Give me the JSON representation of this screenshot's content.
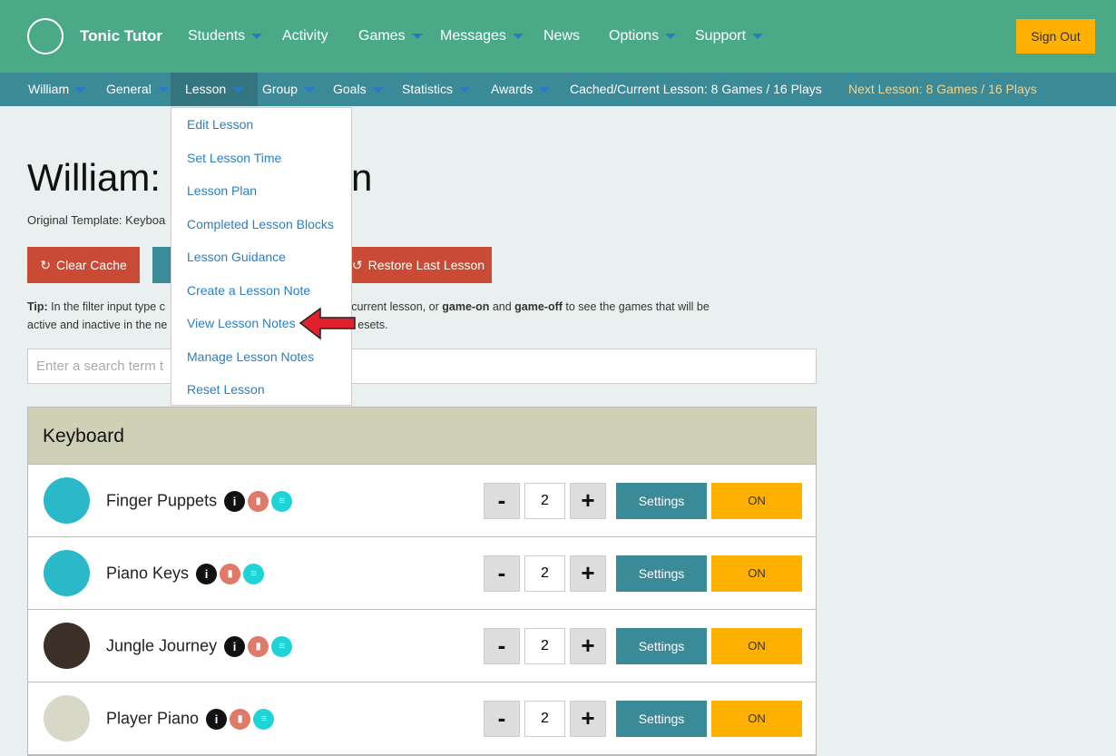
{
  "header": {
    "brand": "Tonic Tutor",
    "nav": [
      {
        "label": "Students",
        "caret": true
      },
      {
        "label": "Activity",
        "caret": false
      },
      {
        "label": "Games",
        "caret": true
      },
      {
        "label": "Messages",
        "caret": true
      },
      {
        "label": "News",
        "caret": false
      },
      {
        "label": "Options",
        "caret": true
      },
      {
        "label": "Support",
        "caret": true
      }
    ],
    "sign_out": "Sign Out"
  },
  "subnav": {
    "items": [
      "William",
      "General",
      "Lesson",
      "Group",
      "Goals",
      "Statistics",
      "Awards"
    ],
    "cached": "Cached/Current Lesson: 8 Games / 16 Plays",
    "next": "Next Lesson: 8 Games / 16 Plays"
  },
  "lesson_menu": [
    "Edit Lesson",
    "Set Lesson Time",
    "Lesson Plan",
    "Completed Lesson Blocks",
    "Lesson Guidance",
    "Create a Lesson Note",
    "View Lesson Notes",
    "Manage Lesson Notes",
    "Reset Lesson"
  ],
  "page": {
    "title_left": "William:",
    "title_right": "n",
    "template": "Original Template: Keyboa",
    "clear_cache": "Clear Cache",
    "restore": "Restore Last Lesson",
    "tip_label": "Tip:",
    "tip_a": " In the filter input type c",
    "tip_b": "mes active in the current lesson, or ",
    "tip_on": "game-on",
    "tip_and": " and ",
    "tip_off": "game-off",
    "tip_c": " to see the games that will be",
    "tip_d": "active and inactive in the ne",
    "tip_e": "esets.",
    "search_placeholder": "Enter a search term t"
  },
  "table": {
    "header": "Keyboard",
    "games": [
      {
        "name": "Finger Puppets",
        "qty": "2",
        "color": "#2bb8c8"
      },
      {
        "name": "Piano Keys",
        "qty": "2",
        "color": "#2bb8c8"
      },
      {
        "name": "Jungle Journey",
        "qty": "2",
        "color": "#3b2f27"
      },
      {
        "name": "Player Piano",
        "qty": "2",
        "color": "#d8d8c8"
      }
    ],
    "settings": "Settings",
    "on": "ON",
    "minus": "-",
    "plus": "+"
  },
  "colors": {
    "header": "#4aaa88",
    "subnav": "#3a8a98",
    "accent": "#ffb000",
    "danger": "#c94b36"
  }
}
